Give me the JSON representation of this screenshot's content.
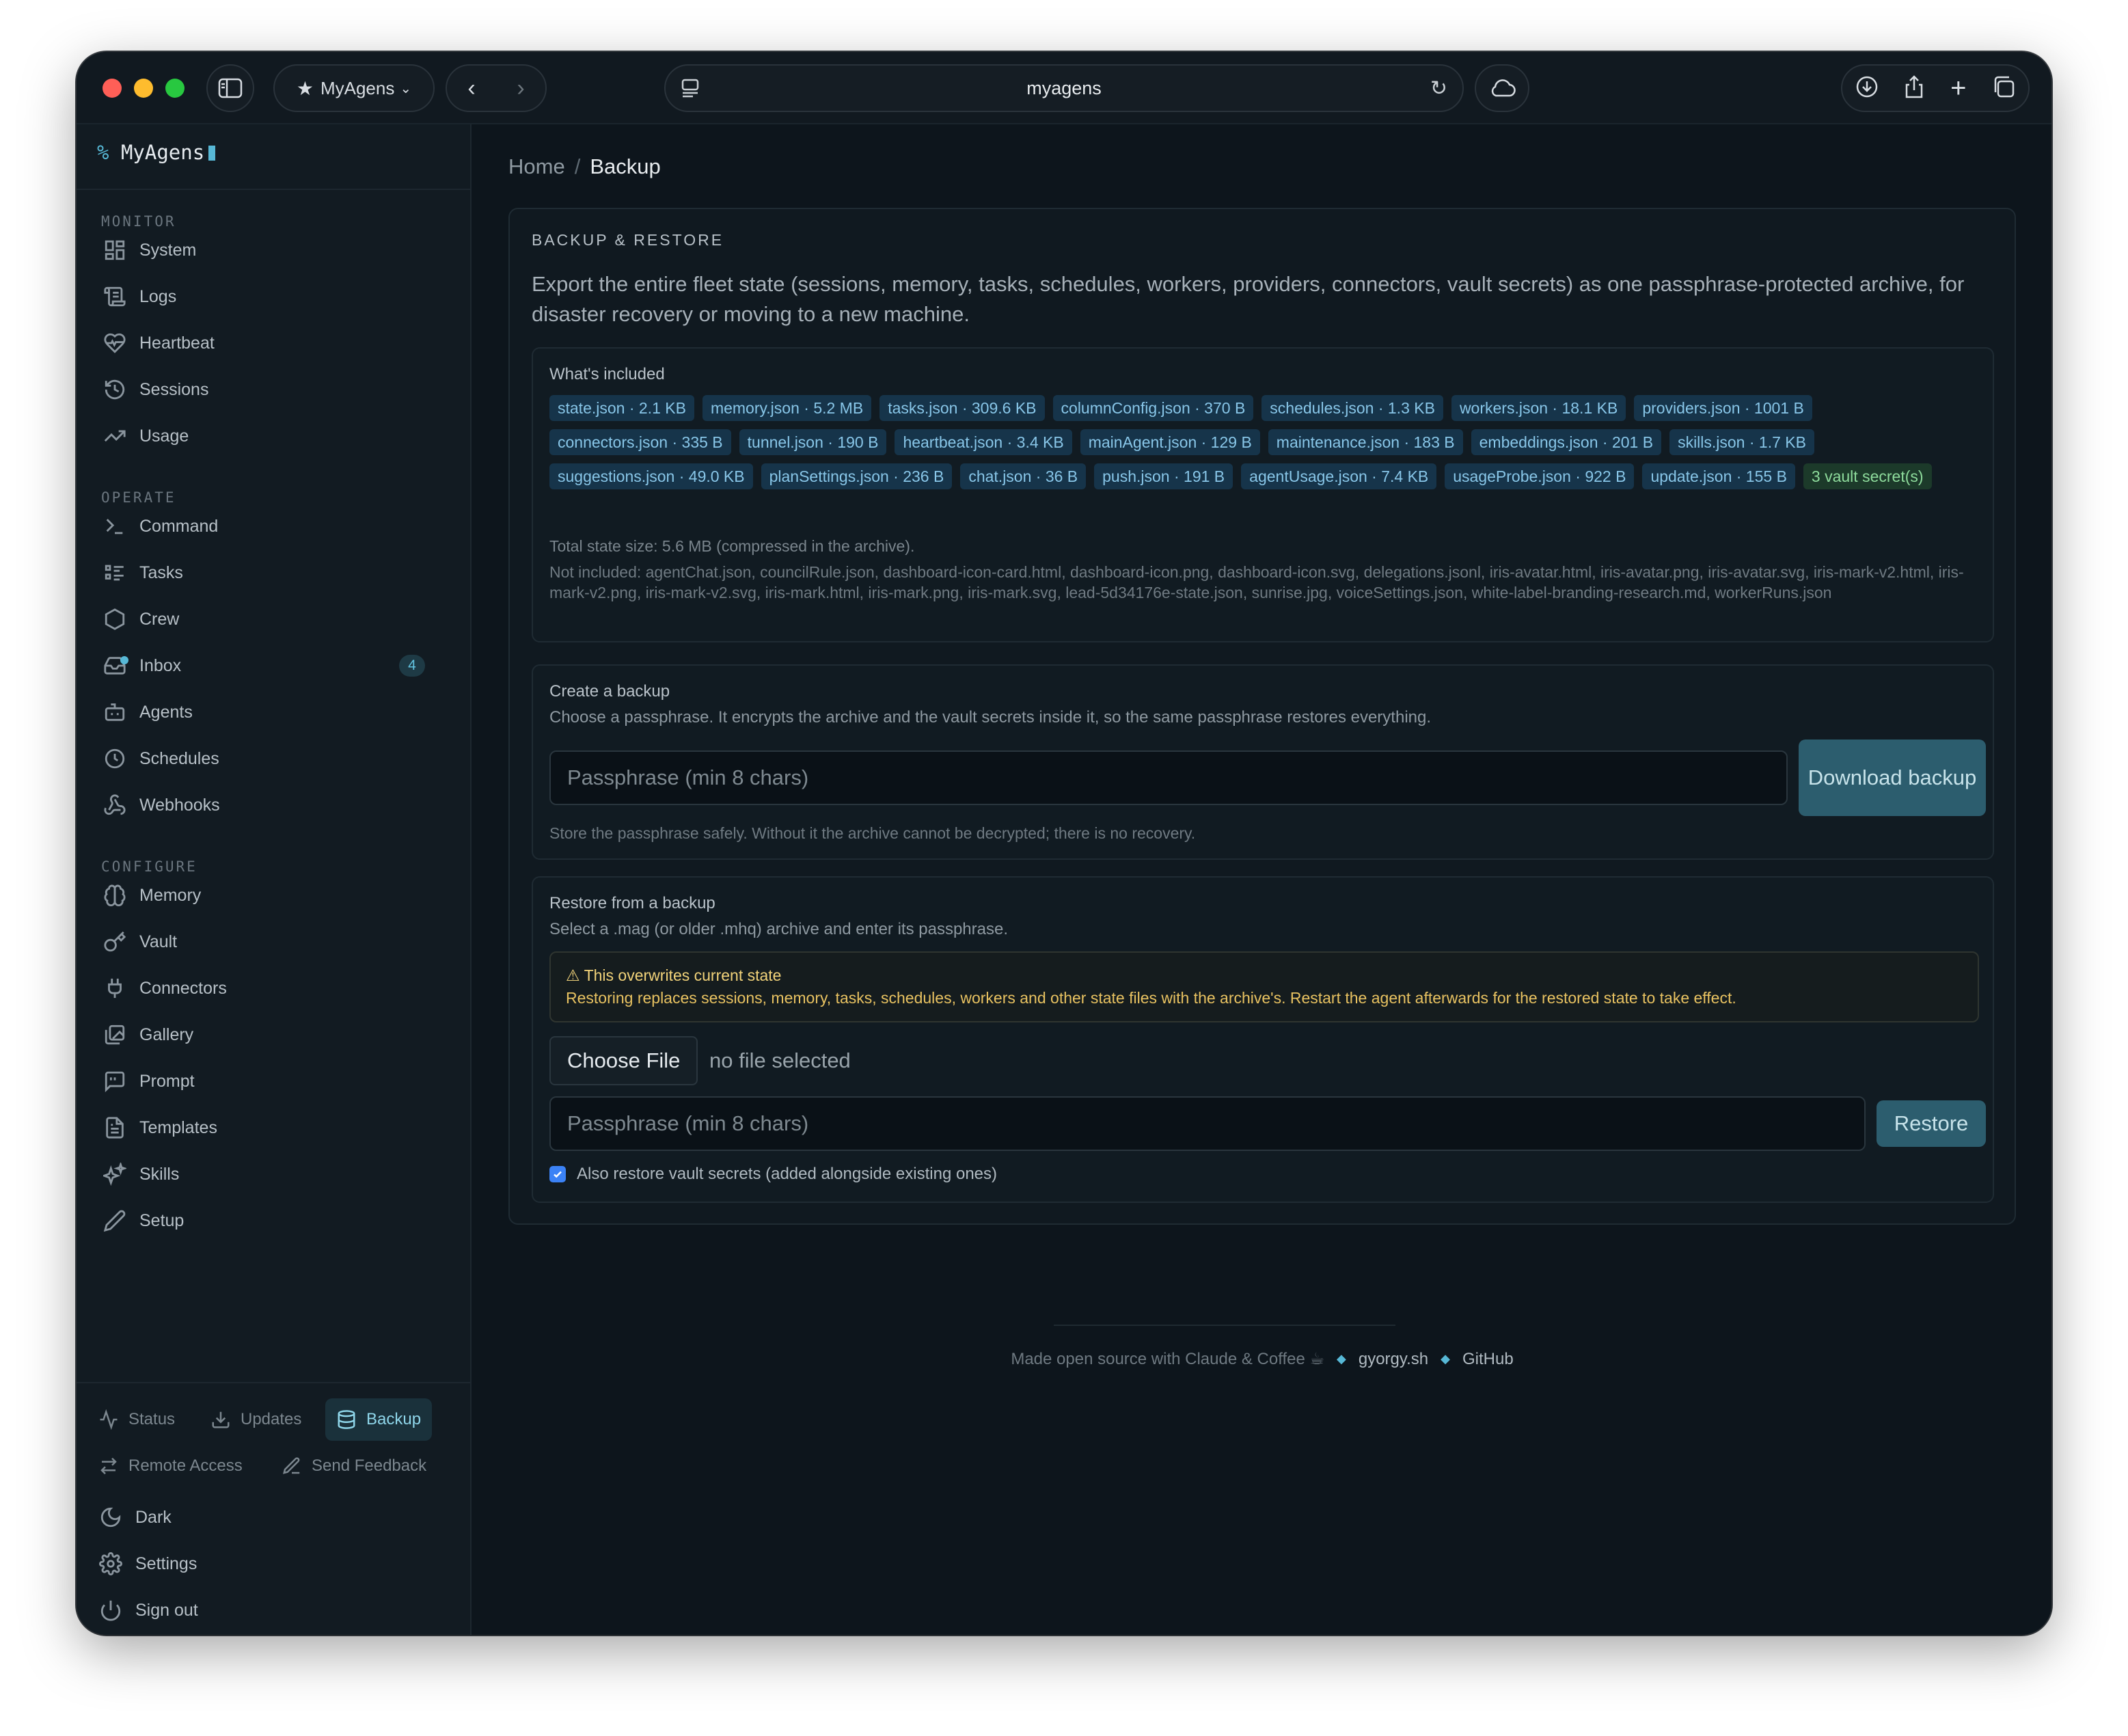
{
  "browser": {
    "profile_label": "MyAgens",
    "url": "myagens"
  },
  "sidebar": {
    "brand": "MyAgens",
    "sections": {
      "monitor": "MONITOR",
      "operate": "OPERATE",
      "configure": "CONFIGURE"
    },
    "monitor_items": [
      "System",
      "Logs",
      "Heartbeat",
      "Sessions",
      "Usage"
    ],
    "operate_items": [
      "Command",
      "Tasks",
      "Crew",
      "Inbox",
      "Agents",
      "Schedules",
      "Webhooks"
    ],
    "inbox_badge": "4",
    "configure_items": [
      "Memory",
      "Vault",
      "Connectors",
      "Gallery",
      "Prompt",
      "Templates",
      "Skills",
      "Setup"
    ],
    "bottom": {
      "status": "Status",
      "updates": "Updates",
      "backup": "Backup",
      "remote_access": "Remote Access",
      "send_feedback": "Send Feedback",
      "dark": "Dark",
      "settings": "Settings",
      "sign_out": "Sign out"
    }
  },
  "breadcrumb": {
    "home": "Home",
    "separator": "/",
    "current": "Backup"
  },
  "backup_panel": {
    "title": "BACKUP & RESTORE",
    "description": "Export the entire fleet state (sessions, memory, tasks, schedules, workers, providers, connectors, vault secrets) as one passphrase-protected archive, for disaster recovery or moving to a new machine.",
    "included": {
      "heading": "What's included",
      "files": [
        "state.json · 2.1 KB",
        "memory.json · 5.2 MB",
        "tasks.json · 309.6 KB",
        "columnConfig.json · 370 B",
        "schedules.json · 1.3 KB",
        "workers.json · 18.1 KB",
        "providers.json · 1001 B",
        "connectors.json · 335 B",
        "tunnel.json · 190 B",
        "heartbeat.json · 3.4 KB",
        "mainAgent.json · 129 B",
        "maintenance.json · 183 B",
        "embeddings.json · 201 B",
        "skills.json · 1.7 KB",
        "suggestions.json · 49.0 KB",
        "planSettings.json · 236 B",
        "chat.json · 36 B",
        "push.json · 191 B",
        "agentUsage.json · 7.4 KB",
        "usageProbe.json · 922 B",
        "update.json · 155 B"
      ],
      "vault_chip": "3 vault secret(s)",
      "total": "Total state size: 5.6 MB (compressed in the archive).",
      "not_included": "Not included: agentChat.json, councilRule.json, dashboard-icon-card.html, dashboard-icon.png, dashboard-icon.svg, delegations.jsonl, iris-avatar.html, iris-avatar.png, iris-avatar.svg, iris-mark-v2.html, iris-mark-v2.png, iris-mark-v2.svg, iris-mark.html, iris-mark.png, iris-mark.svg, lead-5d34176e-state.json, sunrise.jpg, voiceSettings.json, white-label-branding-research.md, workerRuns.json"
    },
    "create": {
      "heading": "Create a backup",
      "subtitle": "Choose a passphrase. It encrypts the archive and the vault secrets inside it, so the same passphrase restores everything.",
      "passphrase_placeholder": "Passphrase (min 8 chars)",
      "download_label": "Download backup",
      "hint": "Store the passphrase safely. Without it the archive cannot be decrypted; there is no recovery."
    },
    "restore": {
      "heading": "Restore from a backup",
      "subtitle": "Select a .mag (or older .mhq) archive and enter its passphrase.",
      "warning_title": "⚠ This overwrites current state",
      "warning_body": "Restoring replaces sessions, memory, tasks, schedules, workers and other state files with the archive's. Restart the agent afterwards for the restored state to take effect.",
      "choose_file": "Choose File",
      "no_file": "no file selected",
      "passphrase_placeholder": "Passphrase (min 8 chars)",
      "restore_label": "Restore",
      "checkbox_label": "Also restore vault secrets (added alongside existing ones)",
      "checkbox_checked": true
    }
  },
  "footer": {
    "made_with": "Made open source with Claude & Coffee ☕",
    "site": "gyorgy.sh",
    "github": "GitHub"
  },
  "colors": {
    "accent": "#57b8d6",
    "background": "#0d151c",
    "warning": "#e8c261",
    "chip": "#16344a"
  }
}
